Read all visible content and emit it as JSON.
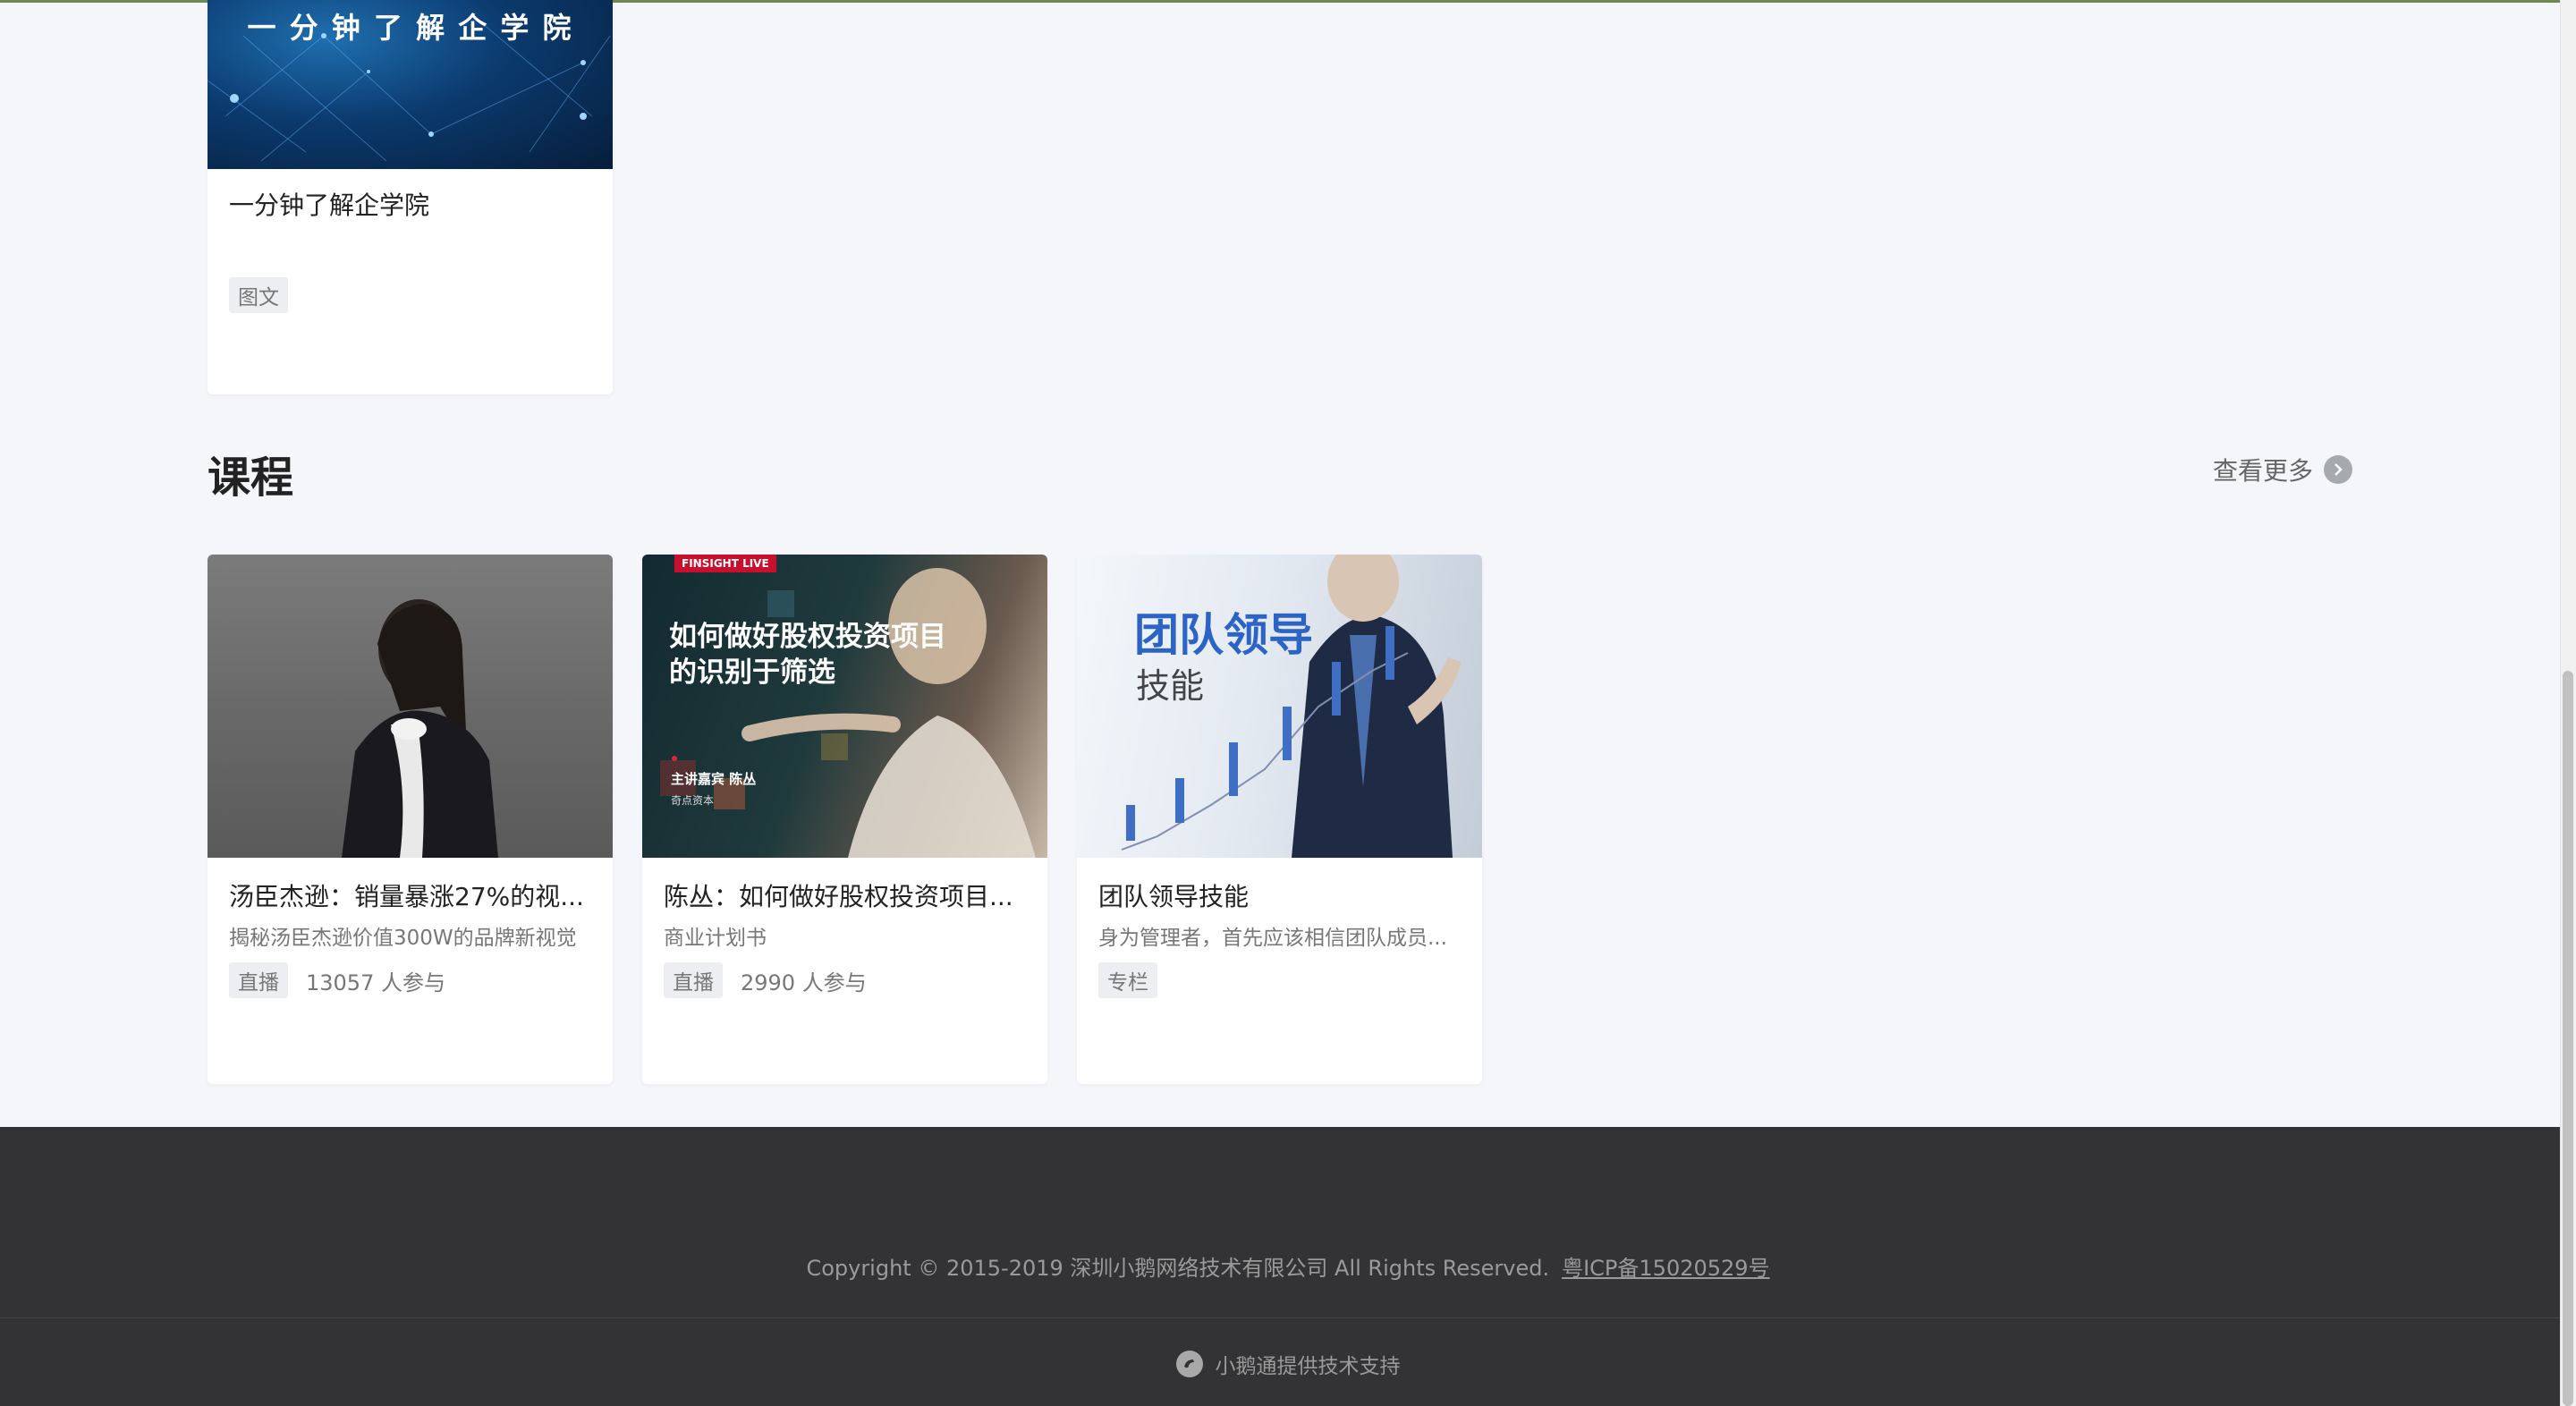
{
  "intro_card": {
    "banner_text": "一 分 钟 了 解 企 学 院",
    "title": "一分钟了解企学院",
    "tag": "图文"
  },
  "section": {
    "title": "课程",
    "more_label": "查看更多"
  },
  "courses": [
    {
      "title": "汤臣杰逊：销量暴涨27%的视...",
      "subtitle": "揭秘汤臣杰逊价值300W的品牌新视觉",
      "tag": "直播",
      "count": "13057 人参与"
    },
    {
      "title": "陈丛：如何做好股权投资项目...",
      "subtitle": "商业计划书",
      "tag": "直播",
      "count": "2990 人参与",
      "thumb": {
        "badge": "FINSIGHT LIVE",
        "headline_1": "如何做好股权投资项目",
        "headline_2": "的识别于筛选",
        "host": "主讲嘉宾 陈丛",
        "org": "奇点资本"
      }
    },
    {
      "title": "团队领导技能",
      "subtitle": "身为管理者，首先应该相信团队成员...",
      "tag": "专栏",
      "thumb": {
        "headline_1": "团队领导",
        "headline_2": "技能"
      }
    }
  ],
  "footer": {
    "copyright": "Copyright © 2015-2019 深圳小鹅网络技术有限公司 All Rights Reserved.",
    "icp": "粤ICP备15020529号",
    "support": "小鹅通提供技术支持"
  },
  "colors": {
    "page_bg": "#f4f6fa",
    "footer_bg": "#333335",
    "tag_bg": "#eceef1"
  }
}
